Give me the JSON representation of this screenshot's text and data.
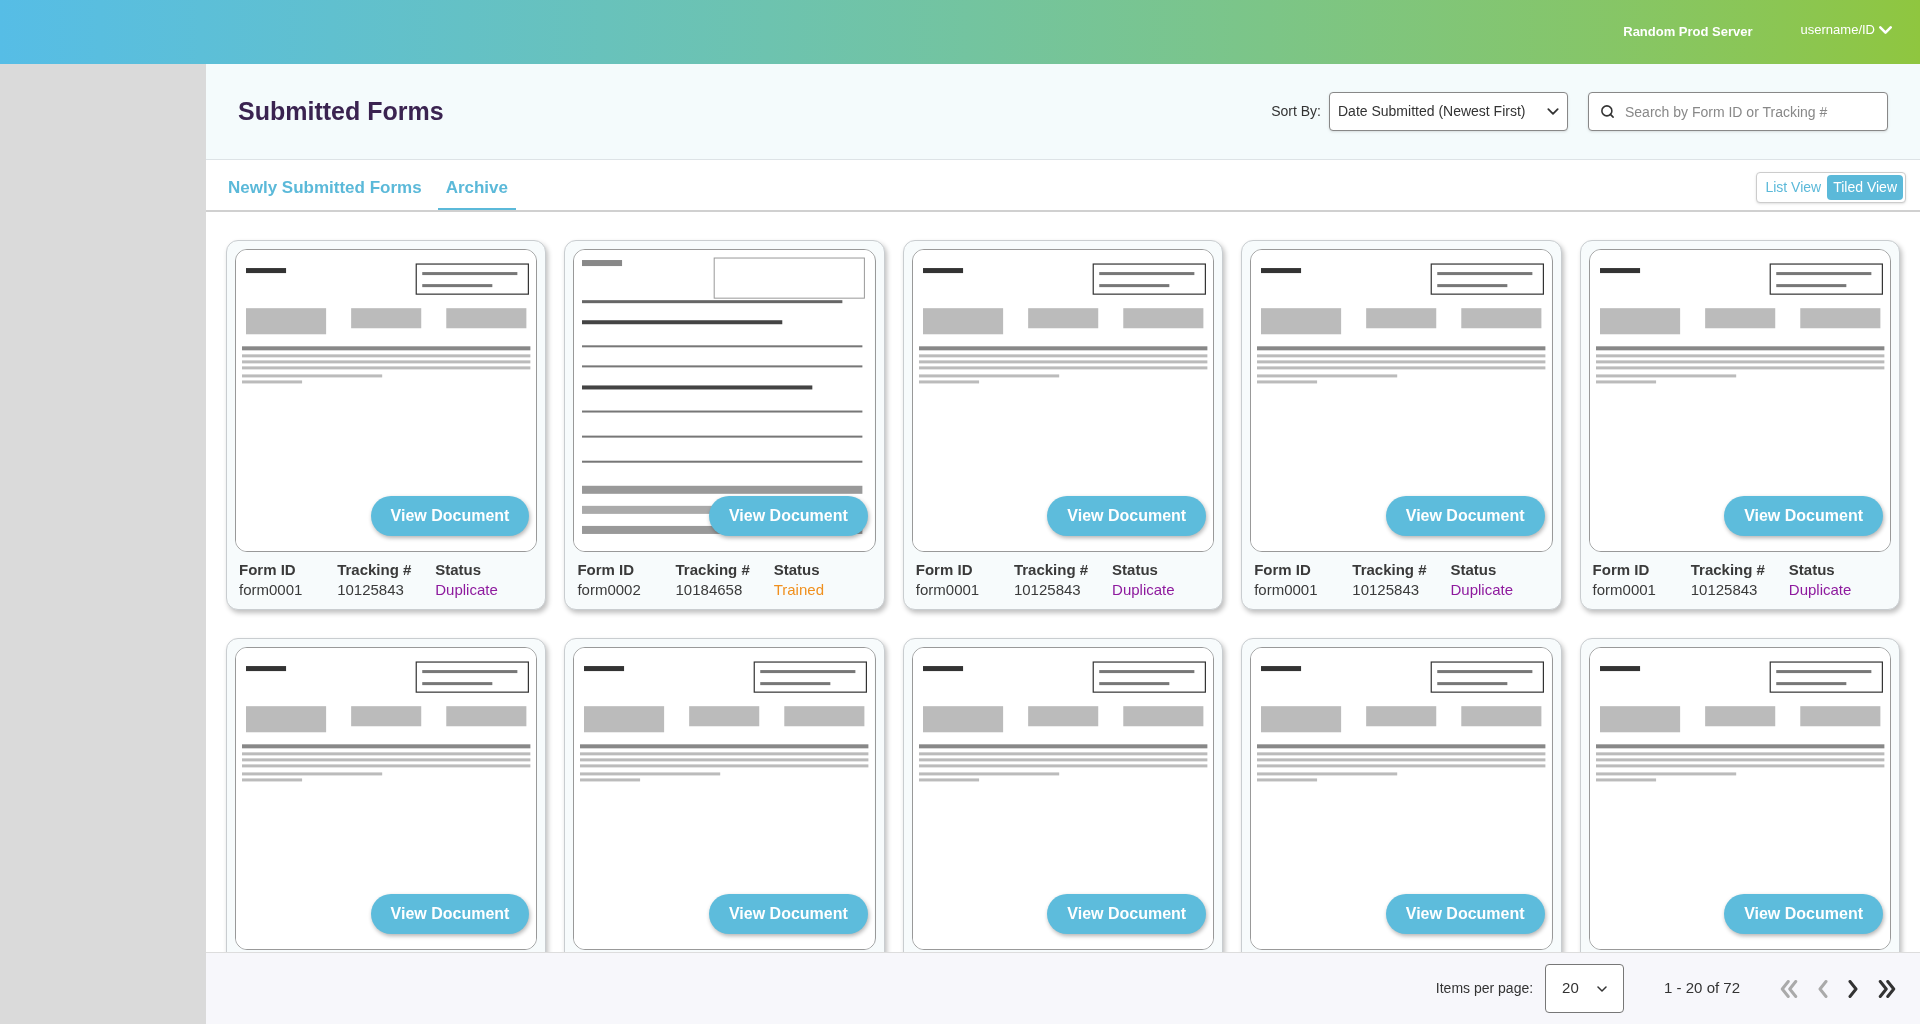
{
  "header": {
    "server": "Random Prod Server",
    "user": "username/ID"
  },
  "page": {
    "title": "Submitted Forms",
    "sort_label": "Sort By:",
    "sort_value": "Date Submitted (Newest First)",
    "search": {
      "placeholder": "Search by Form ID or Tracking #"
    }
  },
  "tabs": [
    {
      "label": "Newly Submitted Forms",
      "selected": false
    },
    {
      "label": "Archive",
      "selected": true
    }
  ],
  "views": [
    {
      "label": "List View",
      "selected": false
    },
    {
      "label": "Tiled View",
      "selected": true
    }
  ],
  "cards": [
    {
      "button": "View Document",
      "info": [
        {
          "label": "Form ID",
          "value": "form0001"
        },
        {
          "label": "Tracking #",
          "value": "10125843"
        },
        {
          "label": "Status",
          "value": "Duplicate",
          "color": "#8e1a9e"
        }
      ]
    },
    {
      "button": "View Document",
      "info": [
        {
          "label": "Form ID",
          "value": "form0002"
        },
        {
          "label": "Tracking #",
          "value": "10184658"
        },
        {
          "label": "Status",
          "value": "Trained",
          "color": "#f0901e"
        }
      ]
    },
    {
      "button": "View Document",
      "info": [
        {
          "label": "Form ID",
          "value": "form0001"
        },
        {
          "label": "Tracking #",
          "value": "10125843"
        },
        {
          "label": "Status",
          "value": "Duplicate",
          "color": "#8e1a9e"
        }
      ]
    },
    {
      "button": "View Document",
      "info": [
        {
          "label": "Form ID",
          "value": "form0001"
        },
        {
          "label": "Tracking #",
          "value": "10125843"
        },
        {
          "label": "Status",
          "value": "Duplicate",
          "color": "#8e1a9e"
        }
      ]
    },
    {
      "button": "View Document",
      "info": [
        {
          "label": "Form ID",
          "value": "form0001"
        },
        {
          "label": "Tracking #",
          "value": "10125843"
        },
        {
          "label": "Status",
          "value": "Duplicate",
          "color": "#8e1a9e"
        }
      ]
    },
    {
      "button": "View Document"
    },
    {
      "button": "View Document"
    },
    {
      "button": "View Document"
    },
    {
      "button": "View Document"
    },
    {
      "button": "View Document"
    }
  ],
  "pagination": {
    "label": "Items per page:",
    "per_page": "20",
    "range": "1 - 20 of 72",
    "first_disabled": true,
    "prev_disabled": true,
    "next_disabled": false,
    "last_disabled": false
  }
}
